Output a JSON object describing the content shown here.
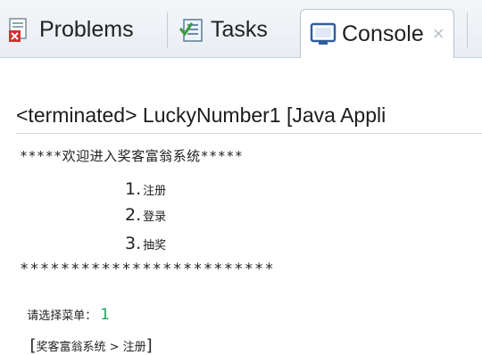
{
  "tabs": [
    {
      "label": "Problems",
      "icon": "problems-icon"
    },
    {
      "label": "Tasks",
      "icon": "tasks-icon"
    },
    {
      "label": "Console",
      "icon": "console-icon",
      "active": true
    }
  ],
  "close_glyph": "×",
  "console": {
    "title": "<terminated> LuckyNumber1 [Java Appli",
    "welcome": "*****欢迎进入奖客富翁系统*****",
    "menu": [
      {
        "num": "1.",
        "text": "注册"
      },
      {
        "num": "2.",
        "text": "登录"
      },
      {
        "num": "3.",
        "text": "抽奖"
      }
    ],
    "stars": "*************************",
    "prompt": "请选择菜单：",
    "prompt_value": "1",
    "status_open": "[",
    "status_text": "奖客富翁系统 > 注册",
    "status_close": "]"
  },
  "colors": {
    "input_green": "#1aa55d",
    "tab_bg": "#e9edf2"
  }
}
